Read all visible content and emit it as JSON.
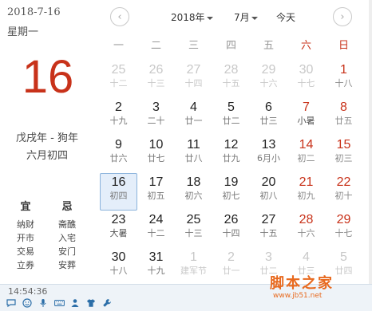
{
  "left": {
    "date_str": "2018-7-16",
    "weekday_str": "星期一",
    "big_day": "16",
    "ganzhi": "戊戌年 - 狗年",
    "lunar": "六月初四",
    "yi_head": "宜",
    "ji_head": "忌",
    "yi_items": [
      "纳财",
      "开市",
      "交易",
      "立券"
    ],
    "ji_items": [
      "斋醮",
      "入宅",
      "安门",
      "安葬"
    ],
    "time": "14:54:36"
  },
  "header": {
    "year": "2018年",
    "month": "7月",
    "today": "今天",
    "prev": "‹",
    "next": "›"
  },
  "weekdays": [
    "一",
    "二",
    "三",
    "四",
    "五",
    "六",
    "日"
  ],
  "weeks": [
    [
      {
        "d": "25",
        "l": "十二",
        "o": true
      },
      {
        "d": "26",
        "l": "十三",
        "o": true
      },
      {
        "d": "27",
        "l": "十四",
        "o": true
      },
      {
        "d": "28",
        "l": "十五",
        "o": true
      },
      {
        "d": "29",
        "l": "十六",
        "o": true
      },
      {
        "d": "30",
        "l": "十七",
        "o": true
      },
      {
        "d": "1",
        "l": "十八",
        "we": true
      }
    ],
    [
      {
        "d": "2",
        "l": "十九"
      },
      {
        "d": "3",
        "l": "二十"
      },
      {
        "d": "4",
        "l": "廿一"
      },
      {
        "d": "5",
        "l": "廿二"
      },
      {
        "d": "6",
        "l": "廿三"
      },
      {
        "d": "7",
        "l": "小暑",
        "we": true,
        "t": true
      },
      {
        "d": "8",
        "l": "廿五",
        "we": true
      }
    ],
    [
      {
        "d": "9",
        "l": "廿六"
      },
      {
        "d": "10",
        "l": "廿七"
      },
      {
        "d": "11",
        "l": "廿八"
      },
      {
        "d": "12",
        "l": "廿九"
      },
      {
        "d": "13",
        "l": "6月小"
      },
      {
        "d": "14",
        "l": "初二",
        "we": true
      },
      {
        "d": "15",
        "l": "初三",
        "we": true
      }
    ],
    [
      {
        "d": "16",
        "l": "初四",
        "s": true
      },
      {
        "d": "17",
        "l": "初五"
      },
      {
        "d": "18",
        "l": "初六"
      },
      {
        "d": "19",
        "l": "初七"
      },
      {
        "d": "20",
        "l": "初八"
      },
      {
        "d": "21",
        "l": "初九",
        "we": true
      },
      {
        "d": "22",
        "l": "初十",
        "we": true
      }
    ],
    [
      {
        "d": "23",
        "l": "大暑",
        "t": true
      },
      {
        "d": "24",
        "l": "十二"
      },
      {
        "d": "25",
        "l": "十三"
      },
      {
        "d": "26",
        "l": "十四"
      },
      {
        "d": "27",
        "l": "十五"
      },
      {
        "d": "28",
        "l": "十六",
        "we": true
      },
      {
        "d": "29",
        "l": "十七",
        "we": true
      }
    ],
    [
      {
        "d": "30",
        "l": "十八"
      },
      {
        "d": "31",
        "l": "十九"
      },
      {
        "d": "1",
        "l": "建军节",
        "o": true
      },
      {
        "d": "2",
        "l": "廿一",
        "o": true
      },
      {
        "d": "3",
        "l": "廿二",
        "o": true
      },
      {
        "d": "4",
        "l": "廿三",
        "o": true
      },
      {
        "d": "5",
        "l": "廿四",
        "o": true
      }
    ]
  ],
  "watermark": "脚本之家",
  "watermark_sub": "www.jb51.net",
  "taskbar_icons": [
    "comment-icon",
    "smile-icon",
    "mic-icon",
    "keyboard-icon",
    "person-icon",
    "shirt-icon",
    "wrench-icon"
  ],
  "colors": {
    "accent_red": "#c8321a",
    "selected_bg": "#e4eefa",
    "selected_border": "#8bb3dc"
  }
}
